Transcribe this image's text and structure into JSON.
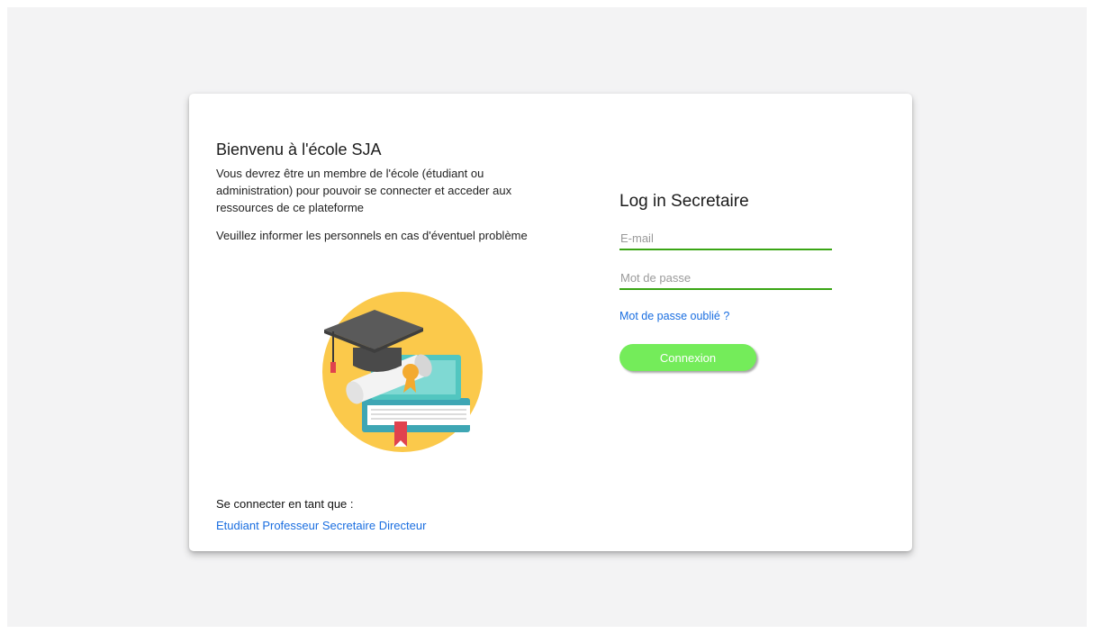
{
  "welcome": {
    "title": "Bienvenu à l'école SJA",
    "intro": "Vous devrez être un membre de l'école (étudiant ou administration) pour pouvoir se connecter et acceder aux ressources de ce plateforme",
    "info": "Veuillez informer les personnels en cas d'éventuel problème"
  },
  "illustration": {
    "icon": "graduation-icon",
    "colors": {
      "circle": "#fbc94b",
      "cap": "#5a5a5a",
      "tassel": "#e0424e",
      "book_top": "#52c6c0",
      "book_bottom": "#3ea6b4",
      "bookmark": "#e0424e",
      "diploma": "#f3f3f3",
      "ribbon": "#f3aa2f"
    }
  },
  "roles": {
    "label": "Se connecter en tant que :",
    "links": [
      "Etudiant",
      "Professeur",
      "Secretaire",
      "Directeur"
    ]
  },
  "login": {
    "title": "Log in Secretaire",
    "email_placeholder": "E-mail",
    "password_placeholder": "Mot de passe",
    "forgot_label": "Mot de passe oublié ?",
    "submit_label": "Connexion"
  },
  "colors": {
    "accent_green": "#74ec5a",
    "underline_green": "#3aa515",
    "link_blue": "#1a6ee0"
  }
}
